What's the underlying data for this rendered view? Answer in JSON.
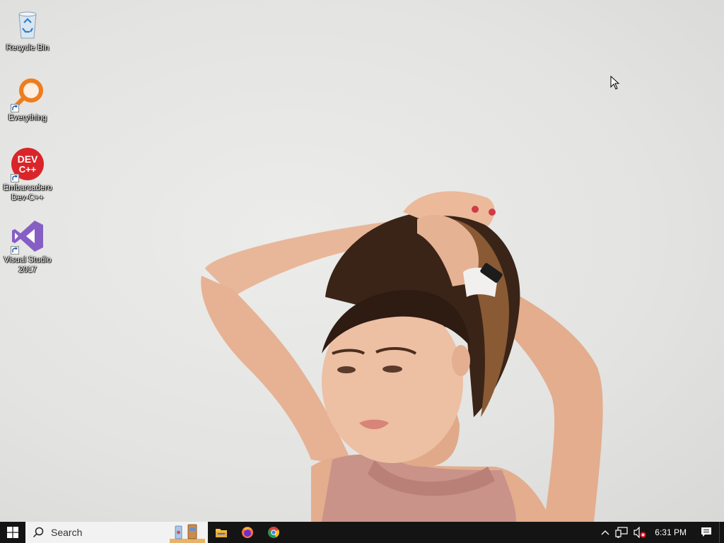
{
  "desktop": {
    "icons": [
      {
        "label": "Recycle Bin",
        "icon": "recycle-bin-icon"
      },
      {
        "label": "Everything",
        "icon": "everything-search-icon"
      },
      {
        "label": "Embarcadero Dev-C++",
        "icon": "devcpp-icon"
      },
      {
        "label": "Visual Studio 2017",
        "icon": "visual-studio-icon"
      }
    ],
    "devcpp_badge": {
      "line1": "DEV",
      "line2": "C++"
    }
  },
  "taskbar": {
    "search_placeholder": "Search",
    "pinned_apps": [
      {
        "name": "File Explorer",
        "icon": "folder-icon"
      },
      {
        "name": "Firefox",
        "icon": "firefox-icon"
      },
      {
        "name": "Google Chrome",
        "icon": "chrome-icon"
      }
    ],
    "tray": {
      "clock": "6:31 PM",
      "icons": [
        "chevron-up-icon",
        "network-icon",
        "volume-muted-icon",
        "action-center-icon"
      ]
    }
  },
  "colors": {
    "taskbar": "#141414",
    "search_bg": "#f2f2f2",
    "windows_blue": "#ffffff",
    "everything_orange": "#f07c1c",
    "devcpp_red": "#d9252a",
    "vs_purple": "#865fc5"
  }
}
